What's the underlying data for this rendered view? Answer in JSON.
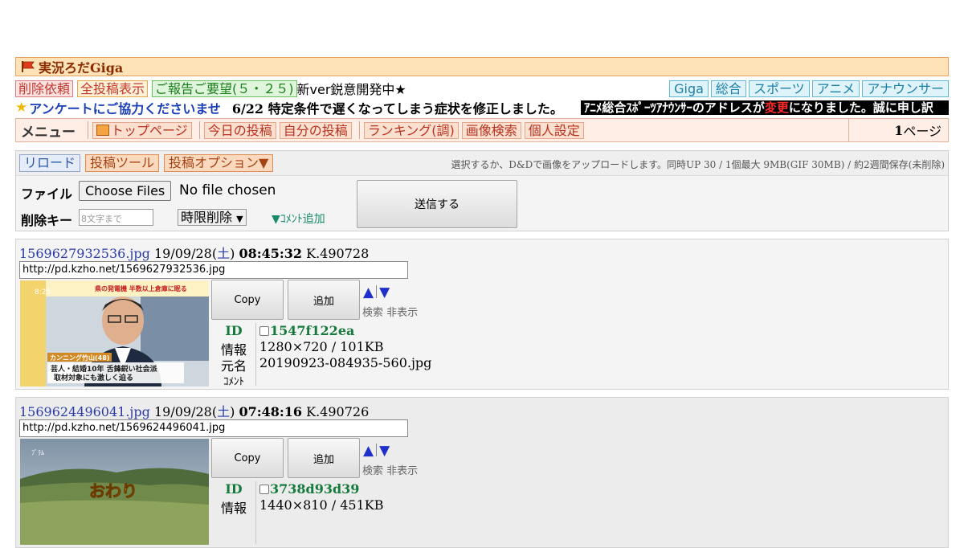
{
  "header": {
    "title": "実況ろだGiga"
  },
  "nav": {
    "delete_request": "削除依頼",
    "all_posts": "全投稿表示",
    "report": "ご報告ご要望(５・２５)",
    "dev_notice": "新ver鋭意開発中★",
    "tabs": [
      "Giga",
      "総合",
      "スポーツ",
      "アニメ",
      "アナウンサー"
    ]
  },
  "announce": {
    "survey": "アンケートにご協力くださいませ",
    "notice": "6/22 特定条件で遅くなってしまう症状を修正しました。",
    "ticker_pre": "ｱﾆﾒ総合ｽﾎﾟｰﾂｱﾅｳﾝｻｰのアドレスが",
    "ticker_red": "変更",
    "ticker_post": "になりました。誠に申し訳"
  },
  "menu": {
    "label": "メニュー",
    "items": [
      "トップページ",
      "今日の投稿",
      "自分の投稿",
      "ランキング(調)",
      "画像検索",
      "個人設定"
    ],
    "page": "1",
    "page_suffix": "ページ"
  },
  "upload": {
    "reload": "リロード",
    "tool": "投稿ツール",
    "options": "投稿オプション▼",
    "hint": "選択するか、D&Dで画像をアップロードします。同時UP 30 / 1個最大 9MB(GIF 30MB) / 約2週間保存(未削除)",
    "file_label": "ファイル",
    "choose_files": "Choose Files",
    "no_file": "No file chosen",
    "delkey_label": "削除キー",
    "delkey_placeholder": "8文字まで",
    "time_delete": "時限削除",
    "comment_add": "▼ｺﾒﾝﾄ追加",
    "submit": "送信する"
  },
  "post_labels": {
    "copy": "Copy",
    "add": "追加",
    "search": "検索",
    "hide": "非表示",
    "id": "ID",
    "info": "情報",
    "original": "元名",
    "comment": "ｺﾒﾝﾄ"
  },
  "posts": [
    {
      "filename": "1569627932536.jpg",
      "date_pre": "19/09/28(",
      "weekday": "土",
      "date_post": ")",
      "time": "08:45:32",
      "k": "K.490728",
      "url": "http://pd.kzho.net/1569627932536.jpg",
      "id": "1547f122ea",
      "info": "1280×720 / 101KB",
      "original": "20190923-084935-560.jpg",
      "thumb_caption_1": "芸人・結婚10年 舌鋒鋭い社会派",
      "thumb_caption_2": "取材対象にも激しく迫る",
      "thumb_name": "カンニング竹山(48)",
      "thumb_banner": "県の発電機 半数以上倉庫に眠る",
      "thumb_time": "8:25"
    },
    {
      "filename": "1569624496041.jpg",
      "date_pre": "19/09/28(",
      "weekday": "土",
      "date_post": ")",
      "time": "07:48:16",
      "k": "K.490726",
      "url": "http://pd.kzho.net/1569624496041.jpg",
      "id": "3738d93d39",
      "info": "1440×810 / 451KB",
      "thumb_text": "おわり",
      "thumb_small": "ﾌﾞﾗﾑ"
    }
  ]
}
